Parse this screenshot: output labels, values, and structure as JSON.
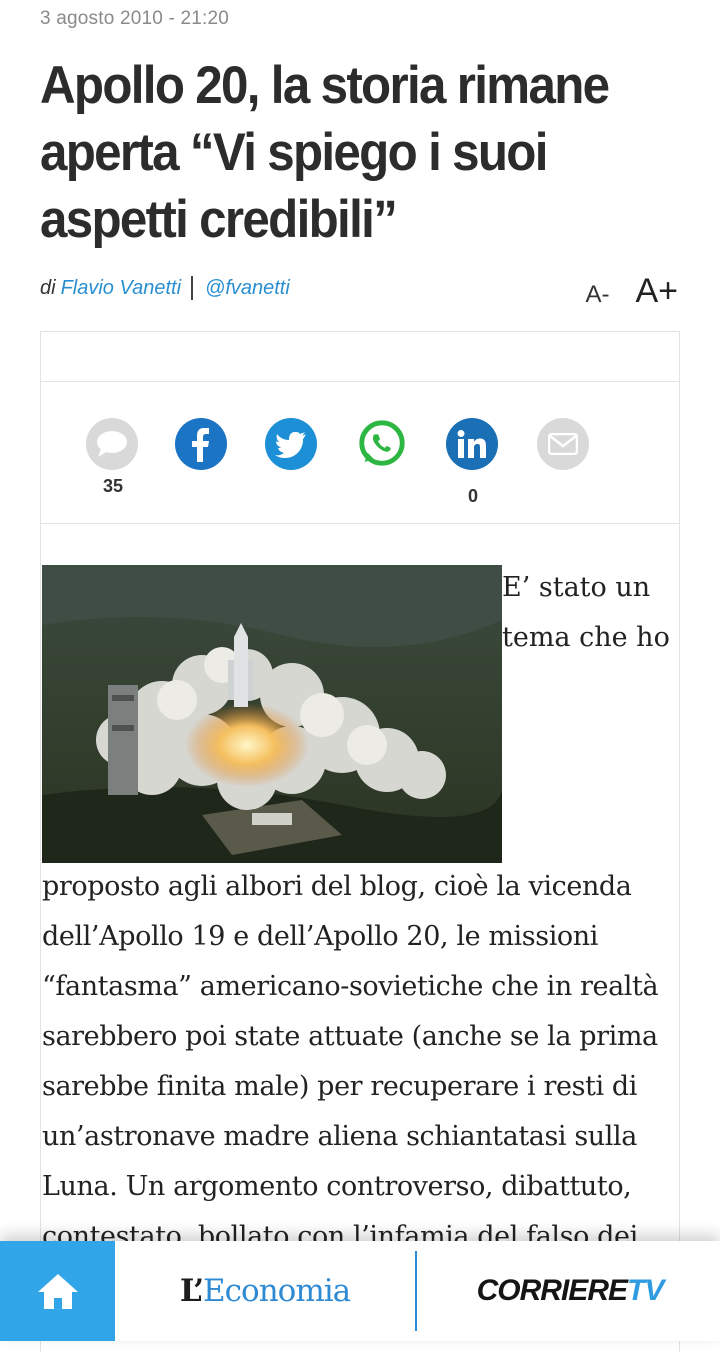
{
  "article": {
    "date": "3 agosto 2010 - 21:20",
    "title": "Apollo 20, la storia rimane aperta “Vi spiego i suoi aspetti credibili”",
    "byline_prefix": "di",
    "author": "Flavio Vanetti",
    "twitter_handle": "@fvanetti",
    "font_decrease_label": "A-",
    "font_increase_label": "A+"
  },
  "share": {
    "comments_count": "35",
    "linkedin_count": "0",
    "icons": [
      "comment-icon",
      "facebook-icon",
      "twitter-icon",
      "whatsapp-icon",
      "linkedin-icon",
      "email-icon"
    ]
  },
  "content": {
    "aside_text": "E’ stato un tema che ho",
    "body_text": "proposto agli albori del blog, cioè la vicenda dell’Apollo 19 e dell’Apollo 20, le missioni “fantasma” americano-sovietiche che in realtà sarebbero poi state attuate (anche se la prima sarebbe finita male) per recuperare i resti di un’astronave madre aliena schiantatasi sulla Luna. Un argomento controverso, dibattuto, contestato, bollato con l’infamia del falso dei"
  },
  "bottom_nav": {
    "economia_prefix": "L’",
    "economia_name": "Economia",
    "corriere_name": "CORRIERE",
    "corriere_suffix": "TV"
  },
  "colors": {
    "accent_blue": "#2a8fd1",
    "facebook": "#1c74c4",
    "twitter": "#1d8fd6",
    "whatsapp": "#2db742",
    "linkedin": "#1a6fb5",
    "home_bg": "#30a6e8"
  }
}
